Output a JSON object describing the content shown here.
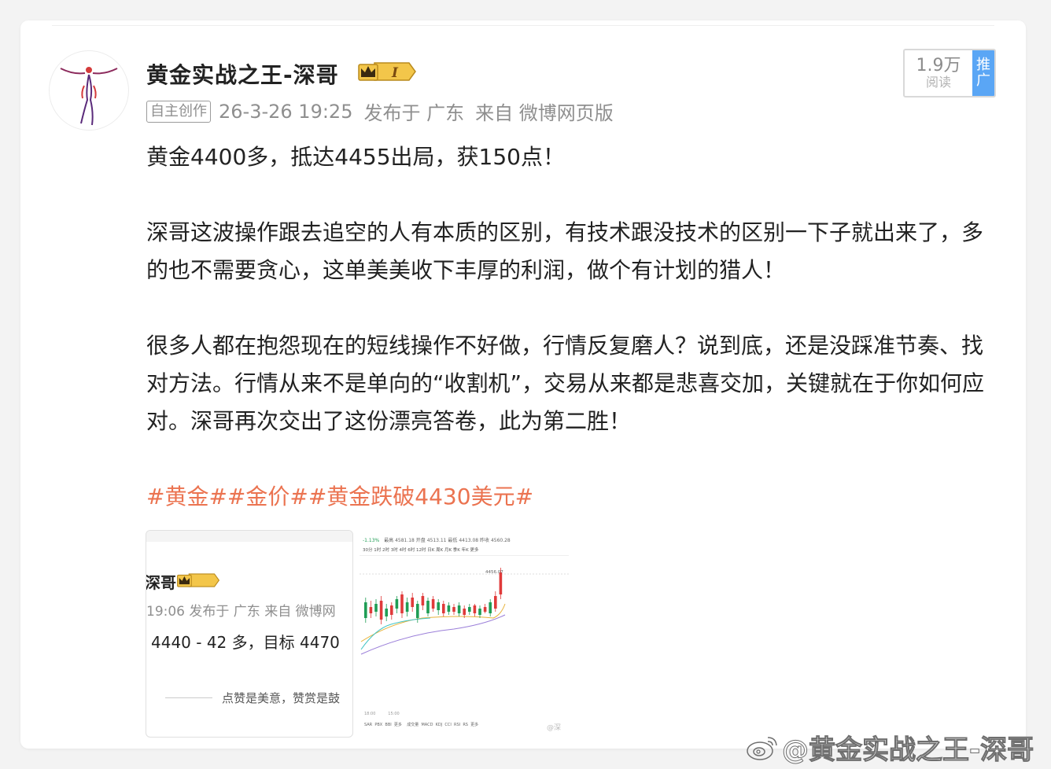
{
  "post": {
    "author": "黄金实战之王-深哥",
    "badge_text": "I",
    "source_tag": "自主创作",
    "timestamp": "26-3-26 19:25",
    "published_from": "发布于 广东",
    "client": "来自 微博网页版",
    "reads_count": "1.9万",
    "reads_label": "阅读",
    "promo_label_1": "推",
    "promo_label_2": "广",
    "paragraphs": [
      "黄金4400多，抵达4455出局，获150点！",
      "深哥这波操作跟去追空的人有本质的区别，有技术跟没技术的区别一下子就出来了，多的也不需要贪心，这单美美收下丰厚的利润，做个有计划的猎人！",
      "很多人都在抱怨现在的短线操作不好做，行情反复磨人？说到底，还是没踩准节奏、找对方法。行情从来不是单向的“收割机”，交易从来都是悲喜交加，关键就在于你如何应对。深哥再次交出了这份漂亮答卷，此为第二胜！"
    ],
    "hashtags": "#黄金##金价##黄金跌破4430美元#"
  },
  "image1": {
    "name": "深哥",
    "meta": "19:06 发布于 广东  来自 微博网",
    "content": "4440 - 42 多，目标 4470",
    "footer": "点赞是美意，赞赏是鼓"
  },
  "image2": {
    "header_change": "-1.13%",
    "header_stats": "最高 4581.18  开盘 4513.11  最低 4413.08  昨收 4560.28",
    "periods": "30分  1时  2时  3时  4时  6时  12时  日K  周K  月K  季K  年K  更多",
    "price_label": "4456.07",
    "bottom_indicators": "SAR  PBX  BBI  更多    成交量  MACD  KDJ  CCI  RSI  RS  更多",
    "time_labels": "18:00          15:00",
    "watermark": "@深"
  },
  "watermark": {
    "text": "@黄金实战之王-深哥"
  },
  "colors": {
    "hashtag": "#eb7350",
    "promo": "#5aa6f5",
    "up_candle": "#e03a3a",
    "down_candle": "#1f9d55"
  }
}
